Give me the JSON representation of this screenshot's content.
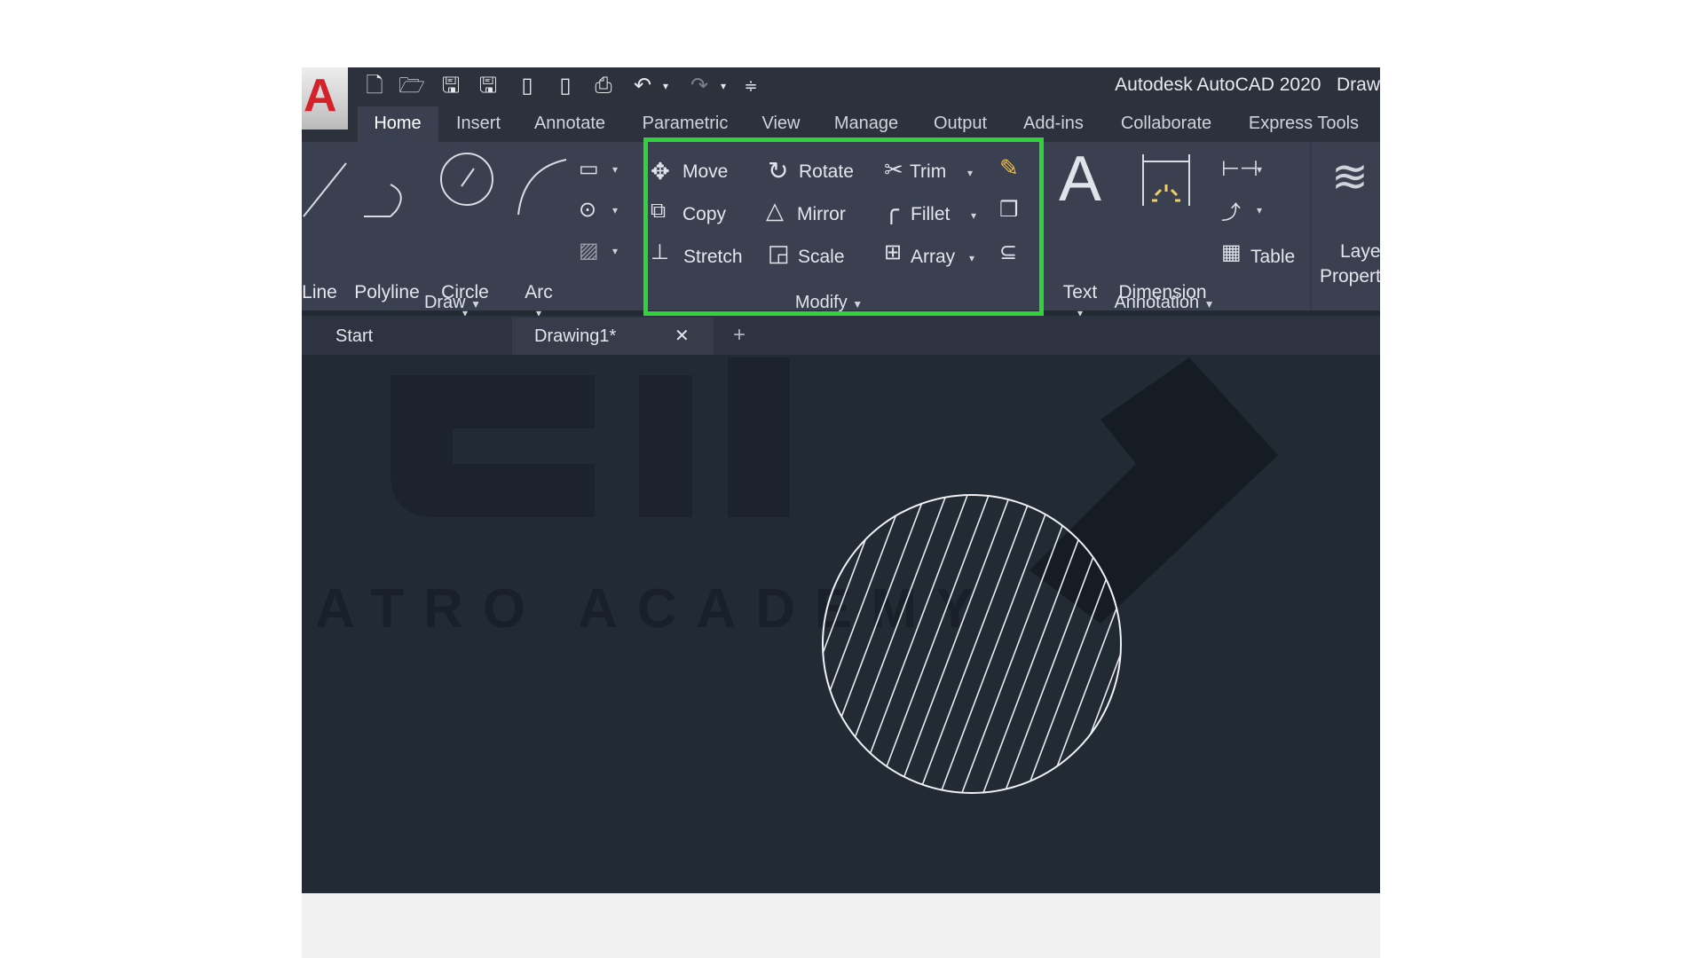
{
  "app": {
    "title": "Autodesk AutoCAD 2020",
    "title_cut": "Draw",
    "logo": "A"
  },
  "quick_access": [
    "new-icon",
    "open-icon",
    "save-icon",
    "save-as-icon",
    "plot-preview-icon",
    "share-icon",
    "print-icon",
    "undo-icon",
    "redo-icon",
    "customize-icon"
  ],
  "menu_tabs": [
    "Home",
    "Insert",
    "Annotate",
    "Parametric",
    "View",
    "Manage",
    "Output",
    "Add-ins",
    "Collaborate",
    "Express Tools"
  ],
  "active_tab": "Home",
  "ribbon": {
    "draw": {
      "title": "Draw",
      "tools": [
        "Line",
        "Polyline",
        "Circle",
        "Arc"
      ]
    },
    "modify": {
      "title": "Modify",
      "tools": [
        "Move",
        "Rotate",
        "Trim",
        "Copy",
        "Mirror",
        "Fillet",
        "Stretch",
        "Scale",
        "Array"
      ]
    },
    "annotation": {
      "title": "Annotation",
      "tools": [
        "Text",
        "Dimension",
        "Table"
      ]
    },
    "layers": {
      "label_line1": "Layer",
      "label_line2": "Propert"
    }
  },
  "highlight_color": "#2fd43a",
  "doc_tabs": {
    "start": "Start",
    "drawing": "Drawing1*",
    "close": "✕",
    "new": "+"
  },
  "watermark": "ATRO ACADEMY"
}
